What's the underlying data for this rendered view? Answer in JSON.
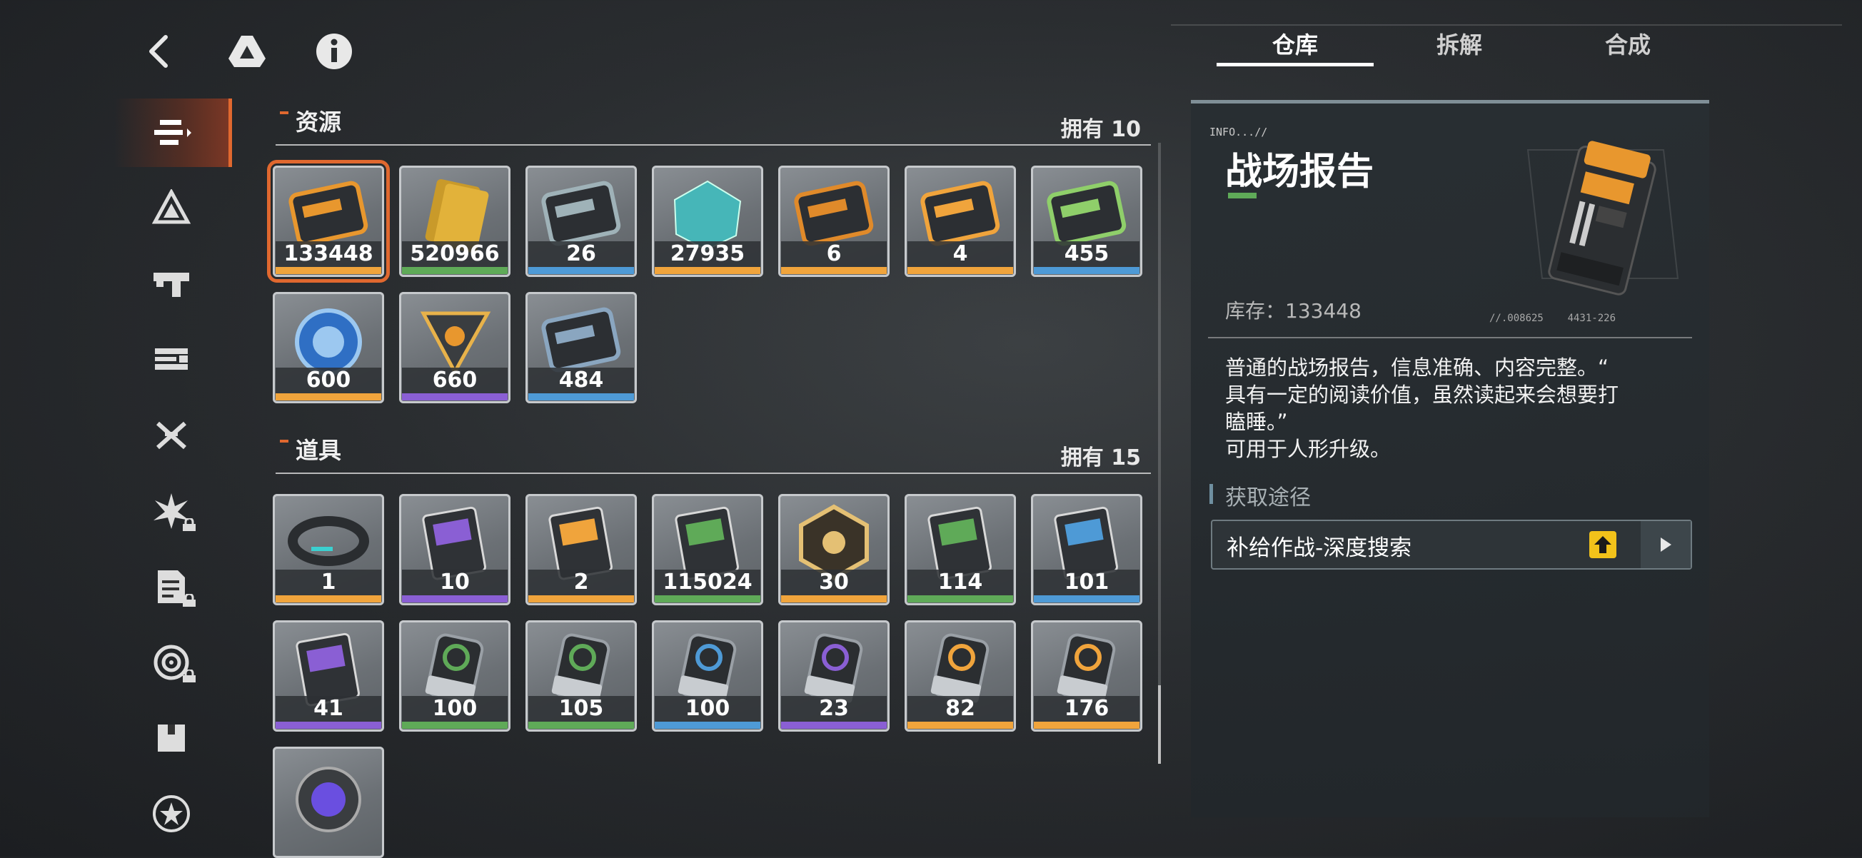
{
  "tabs": [
    "仓库",
    "拆解",
    "合成"
  ],
  "sections": {
    "resources": {
      "title": "资源",
      "count": "拥有 10"
    },
    "items": {
      "title": "道具",
      "count": "拥有 15"
    }
  },
  "resources": [
    {
      "qty": "133448",
      "rarity": "#f0a43c"
    },
    {
      "qty": "520966",
      "rarity": "#5faa58"
    },
    {
      "qty": "26",
      "rarity": "#4e9ad6"
    },
    {
      "qty": "27935",
      "rarity": "#f0a43c"
    },
    {
      "qty": "6",
      "rarity": "#f0a43c"
    },
    {
      "qty": "4",
      "rarity": "#f0a43c"
    },
    {
      "qty": "455",
      "rarity": "#4e9ad6"
    },
    {
      "qty": "600",
      "rarity": "#f0a43c"
    },
    {
      "qty": "660",
      "rarity": "#8a5fd4"
    },
    {
      "qty": "484",
      "rarity": "#4e9ad6"
    }
  ],
  "items": [
    {
      "qty": "1",
      "rarity": "#f0a43c"
    },
    {
      "qty": "10",
      "rarity": "#8a5fd4"
    },
    {
      "qty": "2",
      "rarity": "#f0a43c"
    },
    {
      "qty": "115024",
      "rarity": "#5faa58"
    },
    {
      "qty": "30",
      "rarity": "#f0a43c"
    },
    {
      "qty": "114",
      "rarity": "#5faa58"
    },
    {
      "qty": "101",
      "rarity": "#4e9ad6"
    },
    {
      "qty": "41",
      "rarity": "#8a5fd4"
    },
    {
      "qty": "100",
      "rarity": "#5faa58"
    },
    {
      "qty": "105",
      "rarity": "#5faa58"
    },
    {
      "qty": "100",
      "rarity": "#4e9ad6"
    },
    {
      "qty": "23",
      "rarity": "#8a5fd4"
    },
    {
      "qty": "82",
      "rarity": "#f0a43c"
    },
    {
      "qty": "176",
      "rarity": "#f0a43c"
    },
    {
      "qty": "",
      "rarity": "#8a5fd4"
    }
  ],
  "detail": {
    "info_tag": "INFO...//",
    "title": "战场报告",
    "stock": "库存：133448",
    "serial": "//.008625    4431-226",
    "desc": [
      "普通的战场报告，信息准确、内容完整。“",
      "具有一定的阅读价值，虽然读起来会想要打",
      "瞌睡。”",
      "可用于人形升级。"
    ],
    "source_header": "获取途径",
    "source_route": "补给作战-深度搜索"
  },
  "colors": {
    "accent": "#e0682f",
    "green": "#5faa58",
    "gold": "#f0a43c",
    "blue": "#4e9ad6",
    "purple": "#8a5fd4"
  },
  "icons": {
    "top": [
      "back-arrow-icon",
      "drive-icon",
      "info-icon"
    ],
    "nav": [
      "list-icon",
      "triangle-badge-icon",
      "gun-icon",
      "weapon-part-icon",
      "crossed-blades-icon",
      "burst-icon",
      "document-icon",
      "target-icon",
      "box-icon",
      "star-icon"
    ]
  }
}
